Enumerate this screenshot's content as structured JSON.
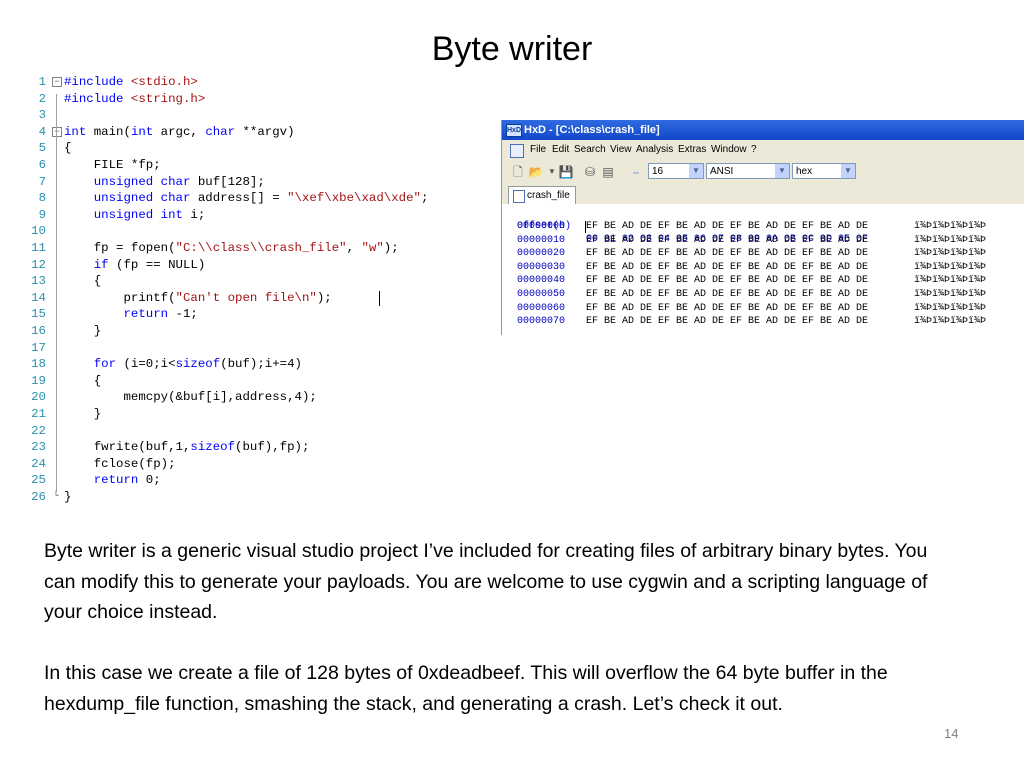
{
  "slide": {
    "title": "Byte writer",
    "paragraph1": "Byte writer is a generic visual studio project I’ve included for creating files of arbitrary binary bytes. You can modify this to generate your payloads. You are welcome to use cygwin and a scripting language of your choice instead.",
    "paragraph2": "In this case we create a file of 128 bytes of 0xdeadbeef. This will overflow the 64 byte buffer in the hexdump_file function, smashing the stack, and generating a crash. Let’s check it out.",
    "page_number": "14"
  },
  "code": {
    "lines": [
      {
        "n": "1",
        "fold": "−",
        "parts": [
          {
            "t": "#include ",
            "c": "kw"
          },
          {
            "t": "<stdio.h>",
            "c": "str"
          }
        ]
      },
      {
        "n": "2",
        "parts": [
          {
            "t": "#include ",
            "c": "kw"
          },
          {
            "t": "<string.h>",
            "c": "str"
          }
        ]
      },
      {
        "n": "3",
        "parts": []
      },
      {
        "n": "4",
        "fold": "−",
        "parts": [
          {
            "t": "int",
            "c": "kw"
          },
          {
            "t": " main("
          },
          {
            "t": "int",
            "c": "kw"
          },
          {
            "t": " argc, "
          },
          {
            "t": "char",
            "c": "kw"
          },
          {
            "t": " **argv)"
          }
        ]
      },
      {
        "n": "5",
        "parts": [
          {
            "t": "{"
          }
        ]
      },
      {
        "n": "6",
        "parts": [
          {
            "t": "    FILE *fp;"
          }
        ]
      },
      {
        "n": "7",
        "parts": [
          {
            "t": "    "
          },
          {
            "t": "unsigned char",
            "c": "kw"
          },
          {
            "t": " buf[128];"
          }
        ]
      },
      {
        "n": "8",
        "parts": [
          {
            "t": "    "
          },
          {
            "t": "unsigned char",
            "c": "kw"
          },
          {
            "t": " address[] = "
          },
          {
            "t": "\"\\xef\\xbe\\xad\\xde\"",
            "c": "str"
          },
          {
            "t": ";"
          }
        ]
      },
      {
        "n": "9",
        "parts": [
          {
            "t": "    "
          },
          {
            "t": "unsigned int",
            "c": "kw"
          },
          {
            "t": " i;"
          }
        ]
      },
      {
        "n": "10",
        "parts": []
      },
      {
        "n": "11",
        "parts": [
          {
            "t": "    fp = fopen("
          },
          {
            "t": "\"C:\\\\class\\\\crash_file\"",
            "c": "str"
          },
          {
            "t": ", "
          },
          {
            "t": "\"w\"",
            "c": "str"
          },
          {
            "t": ");"
          }
        ]
      },
      {
        "n": "12",
        "parts": [
          {
            "t": "    "
          },
          {
            "t": "if",
            "c": "kw"
          },
          {
            "t": " (fp == NULL)"
          }
        ]
      },
      {
        "n": "13",
        "parts": [
          {
            "t": "    {"
          }
        ]
      },
      {
        "n": "14",
        "parts": [
          {
            "t": "        printf("
          },
          {
            "t": "\"Can't open file\\n\"",
            "c": "str"
          },
          {
            "t": ");"
          }
        ]
      },
      {
        "n": "15",
        "parts": [
          {
            "t": "        "
          },
          {
            "t": "return",
            "c": "kw"
          },
          {
            "t": " -1;"
          }
        ]
      },
      {
        "n": "16",
        "parts": [
          {
            "t": "    }"
          }
        ]
      },
      {
        "n": "17",
        "parts": []
      },
      {
        "n": "18",
        "parts": [
          {
            "t": "    "
          },
          {
            "t": "for",
            "c": "kw"
          },
          {
            "t": " (i=0;i<"
          },
          {
            "t": "sizeof",
            "c": "kw"
          },
          {
            "t": "(buf);i+=4)"
          }
        ]
      },
      {
        "n": "19",
        "parts": [
          {
            "t": "    {"
          }
        ]
      },
      {
        "n": "20",
        "parts": [
          {
            "t": "        memcpy(&buf[i],address,4);"
          }
        ]
      },
      {
        "n": "21",
        "parts": [
          {
            "t": "    }"
          }
        ]
      },
      {
        "n": "22",
        "parts": []
      },
      {
        "n": "23",
        "parts": [
          {
            "t": "    fwrite(buf,1,"
          },
          {
            "t": "sizeof",
            "c": "kw"
          },
          {
            "t": "(buf),fp);"
          }
        ]
      },
      {
        "n": "24",
        "parts": [
          {
            "t": "    fclose(fp);"
          }
        ]
      },
      {
        "n": "25",
        "parts": [
          {
            "t": "    "
          },
          {
            "t": "return",
            "c": "kw"
          },
          {
            "t": " 0;"
          }
        ]
      },
      {
        "n": "26",
        "fold": "└",
        "parts": [
          {
            "t": "}"
          }
        ]
      }
    ]
  },
  "hxd": {
    "title": "HxD - [C:\\class\\crash_file]",
    "app_icon": "HxD",
    "menu": [
      "File",
      "Edit",
      "Search",
      "View",
      "Analysis",
      "Extras",
      "Window",
      "?"
    ],
    "toolbar": {
      "bytes_per_row": "16",
      "charset": "ANSI",
      "display_mode": "hex"
    },
    "tab_label": "crash_file",
    "header": {
      "offset_label": "Offset(h)",
      "columns": "00 01 02 03 04 05 06 07 08 09 0A 0B 0C 0D 0E 0F"
    },
    "rows": [
      {
        "offset": "00000000",
        "hex": "EF BE AD DE EF BE AD DE EF BE AD DE EF BE AD DE",
        "ascii": "ï¾­Þï¾­Þï¾­Þï¾­Þ"
      },
      {
        "offset": "00000010",
        "hex": "EF BE AD DE EF BE AD DE EF BE AD DE EF BE AD DE",
        "ascii": "ï¾­Þï¾­Þï¾­Þï¾­Þ"
      },
      {
        "offset": "00000020",
        "hex": "EF BE AD DE EF BE AD DE EF BE AD DE EF BE AD DE",
        "ascii": "ï¾­Þï¾­Þï¾­Þï¾­Þ"
      },
      {
        "offset": "00000030",
        "hex": "EF BE AD DE EF BE AD DE EF BE AD DE EF BE AD DE",
        "ascii": "ï¾­Þï¾­Þï¾­Þï¾­Þ"
      },
      {
        "offset": "00000040",
        "hex": "EF BE AD DE EF BE AD DE EF BE AD DE EF BE AD DE",
        "ascii": "ï¾­Þï¾­Þï¾­Þï¾­Þ"
      },
      {
        "offset": "00000050",
        "hex": "EF BE AD DE EF BE AD DE EF BE AD DE EF BE AD DE",
        "ascii": "ï¾­Þï¾­Þï¾­Þï¾­Þ"
      },
      {
        "offset": "00000060",
        "hex": "EF BE AD DE EF BE AD DE EF BE AD DE EF BE AD DE",
        "ascii": "ï¾­Þï¾­Þï¾­Þï¾­Þ"
      },
      {
        "offset": "00000070",
        "hex": "EF BE AD DE EF BE AD DE EF BE AD DE EF BE AD DE",
        "ascii": "ï¾­Þï¾­Þï¾­Þï¾­Þ"
      }
    ]
  },
  "colors": {
    "keyword": "#0000ff",
    "string": "#a31515",
    "line_number": "#2b91af",
    "titlebar": "#1f5ad6"
  }
}
